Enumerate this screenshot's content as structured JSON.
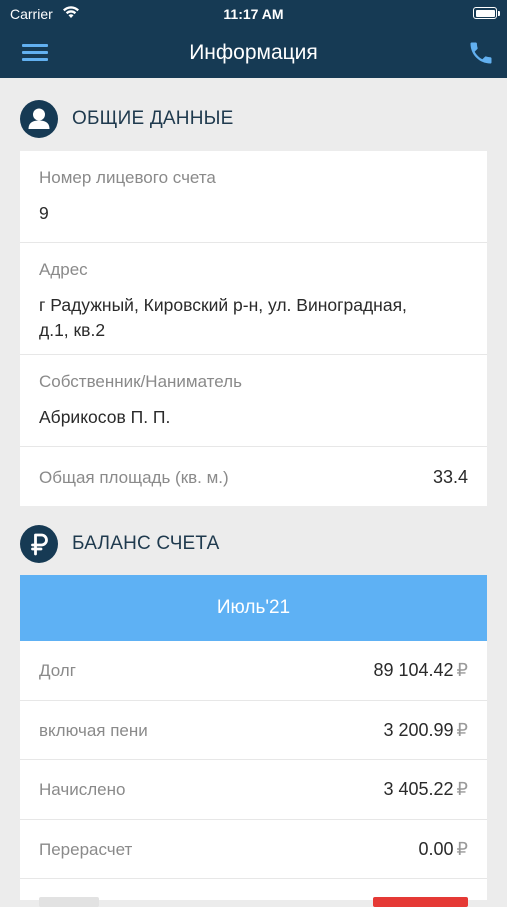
{
  "status": {
    "carrier": "Carrier",
    "time": "11:17 AM"
  },
  "nav": {
    "title": "Информация"
  },
  "general": {
    "heading": "ОБЩИЕ ДАННЫЕ",
    "account_label": "Номер лицевого счета",
    "account_value": "9",
    "address_label": "Адрес",
    "address_line1": "г Радужный, Кировский р-н, ул. Виноградная,",
    "address_line2": "д.1, кв.2",
    "owner_label": "Собственник/Наниматель",
    "owner_value": "Абрикосов П. П.",
    "area_label": "Общая площадь (кв. м.)",
    "area_value": "33.4"
  },
  "balance": {
    "heading": "БАЛАНС СЧЕТА",
    "month": "Июль'21",
    "currency": "₽",
    "rows": [
      {
        "label": "Долг",
        "value": "89 104.42"
      },
      {
        "label": "включая пени",
        "value": "3 200.99"
      },
      {
        "label": "Начислено",
        "value": "3 405.22"
      },
      {
        "label": "Перерасчет",
        "value": "0.00"
      }
    ],
    "partial_value_color": "#e53935"
  },
  "colors": {
    "navbar": "#163a54",
    "accent": "#5eb1f4",
    "menu_icon": "#62b0f0"
  }
}
